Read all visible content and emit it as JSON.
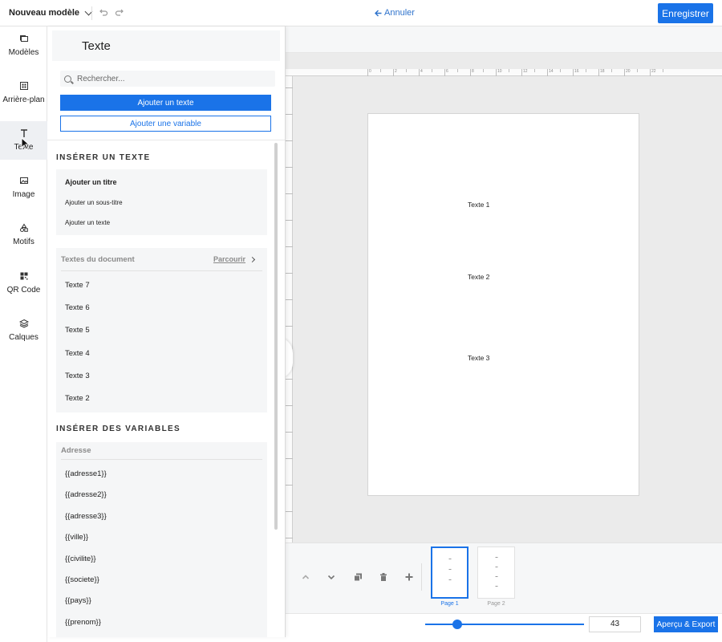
{
  "topbar": {
    "title": "Nouveau modèle",
    "cancel_label": "Annuler",
    "save_label": "Enregistrer",
    "icons": [
      "chevron-down-icon",
      "undo-icon",
      "redo-icon",
      "arrow-left-icon"
    ]
  },
  "rail": {
    "items": [
      {
        "label": "Modèles",
        "icon": "folders-icon"
      },
      {
        "label": "Arrière-plan",
        "icon": "grid-icon"
      },
      {
        "label": "Texte",
        "icon": "text-icon",
        "active": true
      },
      {
        "label": "Image",
        "icon": "image-icon"
      },
      {
        "label": "Motifs",
        "icon": "shapes-icon"
      },
      {
        "label": "QR Code",
        "icon": "qr-code-icon"
      },
      {
        "label": "Calques",
        "icon": "layers-icon"
      }
    ]
  },
  "panel": {
    "title": "Texte",
    "search_placeholder": "Rechercher...",
    "add_text_label": "Ajouter un texte",
    "add_variable_label": "Ajouter une variable",
    "insert_text_heading": "INSÉRER UN TEXTE",
    "insert_text": {
      "title": "Ajouter un titre",
      "subtitle": "Ajouter un sous-titre",
      "text": "Ajouter un texte"
    },
    "doc_texts": {
      "header": "Textes du document",
      "browse": "Parcourir",
      "items": [
        "Texte 7",
        "Texte 6",
        "Texte 5",
        "Texte 4",
        "Texte 3",
        "Texte 2"
      ]
    },
    "insert_variables_heading": "INSÉRER DES VARIABLES",
    "variables": {
      "group": "Adresse",
      "items": [
        "{{adresse1}}",
        "{{adresse2}}",
        "{{adresse3}}",
        "{{ville}}",
        "{{civilite}}",
        "{{societe}}",
        "{{pays}}",
        "{{prenom}}"
      ]
    }
  },
  "ruler": {
    "h_labels": [
      "0",
      "2",
      "4",
      "6",
      "8",
      "10",
      "12",
      "14",
      "16",
      "18",
      "20",
      "22"
    ]
  },
  "canvas": {
    "texts": [
      "Texte 1",
      "Texte 2",
      "Texte 3"
    ]
  },
  "pages": {
    "thumbs": [
      {
        "label": "Page 1",
        "active": true
      },
      {
        "label": "Page 2",
        "active": false
      }
    ],
    "tool_icons": [
      "chevron-up-icon",
      "chevron-down-icon",
      "duplicate-icon",
      "trash-icon",
      "plus-icon"
    ]
  },
  "footer": {
    "zoom_value": "43",
    "zoom_fraction": 0.2,
    "preview_label": "Aperçu & Export"
  },
  "colors": {
    "accent": "#1a73e8",
    "link": "#2f73cc",
    "workspace": "#ebebeb"
  }
}
